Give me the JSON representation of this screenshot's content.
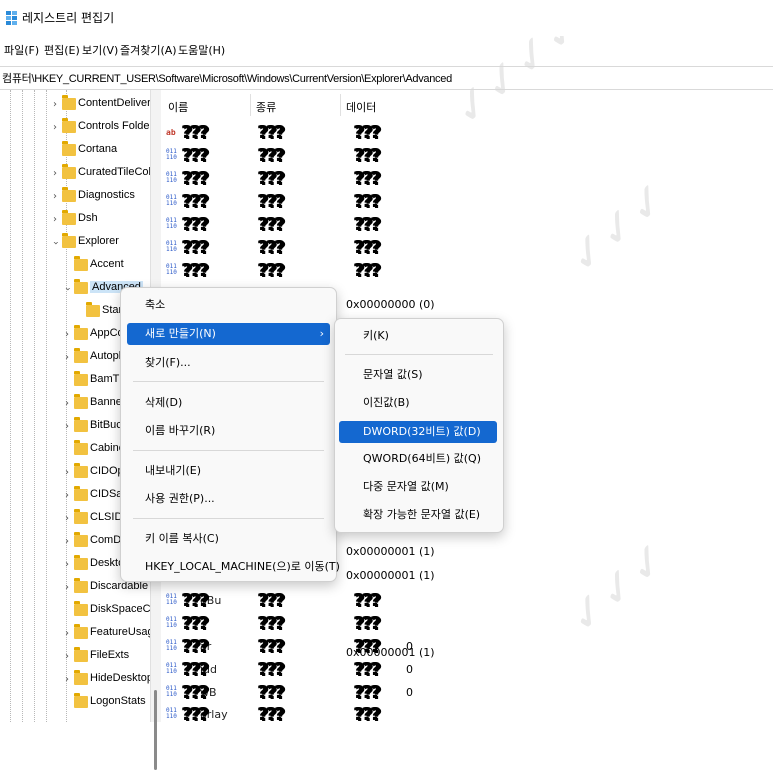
{
  "window": {
    "title": "레지스트리 편집기"
  },
  "menu": [
    "파일(F)",
    "편집(E)",
    "보기(V)",
    "즐겨찾기(A)",
    "도움말(H)"
  ],
  "address": "컴퓨터\\HKEY_CURRENT_USER\\Software\\Microsoft\\Windows\\CurrentVersion\\Explorer\\Advanced",
  "tree": [
    {
      "label": "ContentDeliveryM"
    },
    {
      "label": "Controls Folder ("
    },
    {
      "label": "Cortana"
    },
    {
      "label": "CuratedTileCollec"
    },
    {
      "label": "Diagnostics"
    },
    {
      "label": "Dsh"
    },
    {
      "label": "Explorer"
    },
    {
      "label": "Accent"
    },
    {
      "label": "Advanced"
    },
    {
      "label": "Star"
    },
    {
      "label": "AppCo"
    },
    {
      "label": "Autopl"
    },
    {
      "label": "BamTh"
    },
    {
      "label": "Banner"
    },
    {
      "label": "BitBuck"
    },
    {
      "label": "Cabine"
    },
    {
      "label": "CIDOp"
    },
    {
      "label": "CIDSav"
    },
    {
      "label": "CLSID"
    },
    {
      "label": "ComD"
    },
    {
      "label": "Deskto"
    },
    {
      "label": "Discardable"
    },
    {
      "label": "DiskSpaceChe"
    },
    {
      "label": "FeatureUsage"
    },
    {
      "label": "FileExts"
    },
    {
      "label": "HideDesktopIc"
    },
    {
      "label": "LogonStats"
    }
  ],
  "columns": {
    "name": "이름",
    "type": "종류",
    "data": "데이터"
  },
  "redacted": "???",
  "values": [
    {
      "data": "0x00000000 (0)"
    },
    {
      "data": "0x00000001 (1)"
    },
    {
      "data": "0x00000001 (1)"
    },
    {
      "data": "0x00000001 (1)"
    }
  ],
  "partial_names": [
    "eBu",
    "ar",
    "idd",
    "wB",
    "erlay"
  ],
  "partial_data": [
    "0",
    "0",
    "0"
  ],
  "context_menu": {
    "items": [
      "축소",
      "새로 만들기(N)",
      "찾기(F)...",
      "삭제(D)",
      "이름 바꾸기(R)",
      "내보내기(E)",
      "사용 권한(P)...",
      "키 이름 복사(C)",
      "HKEY_LOCAL_MACHINE(으)로 이동(T)"
    ],
    "arrow": "›"
  },
  "submenu": {
    "items": [
      "키(K)",
      "문자열 값(S)",
      "이진값(B)",
      "DWORD(32비트) 값(D)",
      "QWORD(64비트) 값(Q)",
      "다중 문자열 값(M)",
      "확장 가능한 문자열 값(E)"
    ]
  },
  "colors": {
    "highlight": "#1468d0",
    "folder": "#f2c240"
  }
}
